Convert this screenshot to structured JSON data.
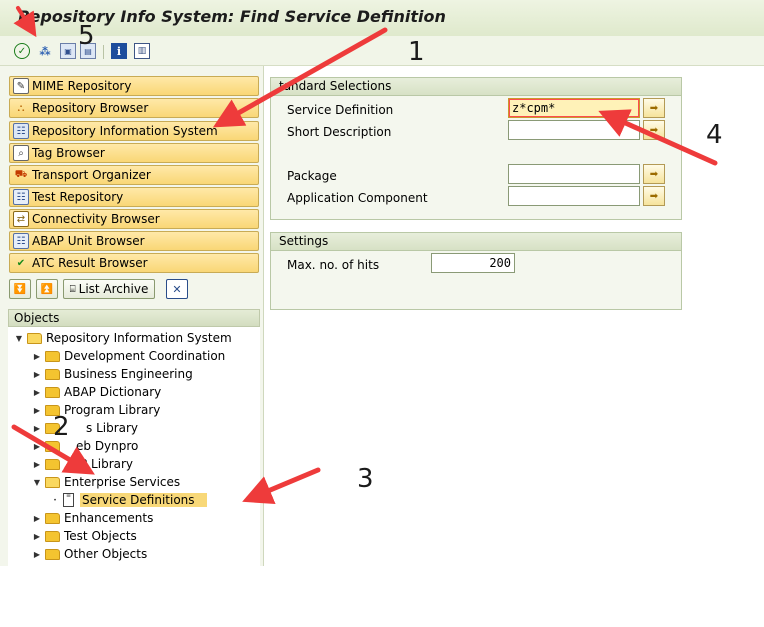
{
  "window": {
    "title": "Repository Info System: Find Service Definition"
  },
  "toolbar": {
    "icons": [
      "execute-icon",
      "hierarchy-icon",
      "copy-icon",
      "info-icon",
      "columns-icon"
    ]
  },
  "navigation": {
    "buttons": [
      {
        "label": "MIME Repository",
        "icon": "mime-icon"
      },
      {
        "label": "Repository Browser",
        "icon": "hierarchy-icon"
      },
      {
        "label": "Repository Information System",
        "icon": "info-system-icon"
      },
      {
        "label": "Tag Browser",
        "icon": "tag-icon"
      },
      {
        "label": "Transport Organizer",
        "icon": "truck-icon"
      },
      {
        "label": "Test Repository",
        "icon": "test-icon"
      },
      {
        "label": "Connectivity Browser",
        "icon": "connectivity-icon"
      },
      {
        "label": "ABAP Unit Browser",
        "icon": "unit-icon"
      },
      {
        "label": "ATC Result Browser",
        "icon": "atc-icon"
      }
    ],
    "list_archive_label": "List Archive"
  },
  "objects": {
    "header": "Objects",
    "root": "Repository Information System",
    "items": [
      {
        "label": "Development Coordination"
      },
      {
        "label": "Business Engineering"
      },
      {
        "label": "ABAP Dictionary"
      },
      {
        "label": "Program Library"
      },
      {
        "label": "s Library"
      },
      {
        "label": "eb Dynpro"
      },
      {
        "label": "P Library"
      },
      {
        "label": "Enterprise Services"
      },
      {
        "label": "Service Definitions"
      },
      {
        "label": "Enhancements"
      },
      {
        "label": "Test Objects"
      },
      {
        "label": "Other Objects"
      }
    ]
  },
  "standard_selections": {
    "header": "tandard Selections",
    "service_definition": {
      "label": "Service Definition",
      "value": "z*cpm*"
    },
    "short_description": {
      "label": "Short Description",
      "value": ""
    },
    "package": {
      "label": "Package",
      "value": ""
    },
    "application_component": {
      "label": "Application Component",
      "value": ""
    }
  },
  "settings": {
    "header": "Settings",
    "max_hits": {
      "label": "Max. no. of hits",
      "value": "200"
    }
  },
  "annotations": {
    "n1": "1",
    "n2": "2",
    "n3": "3",
    "n4": "4",
    "n5": "5",
    "arrow_color": "#ee3b3b"
  }
}
